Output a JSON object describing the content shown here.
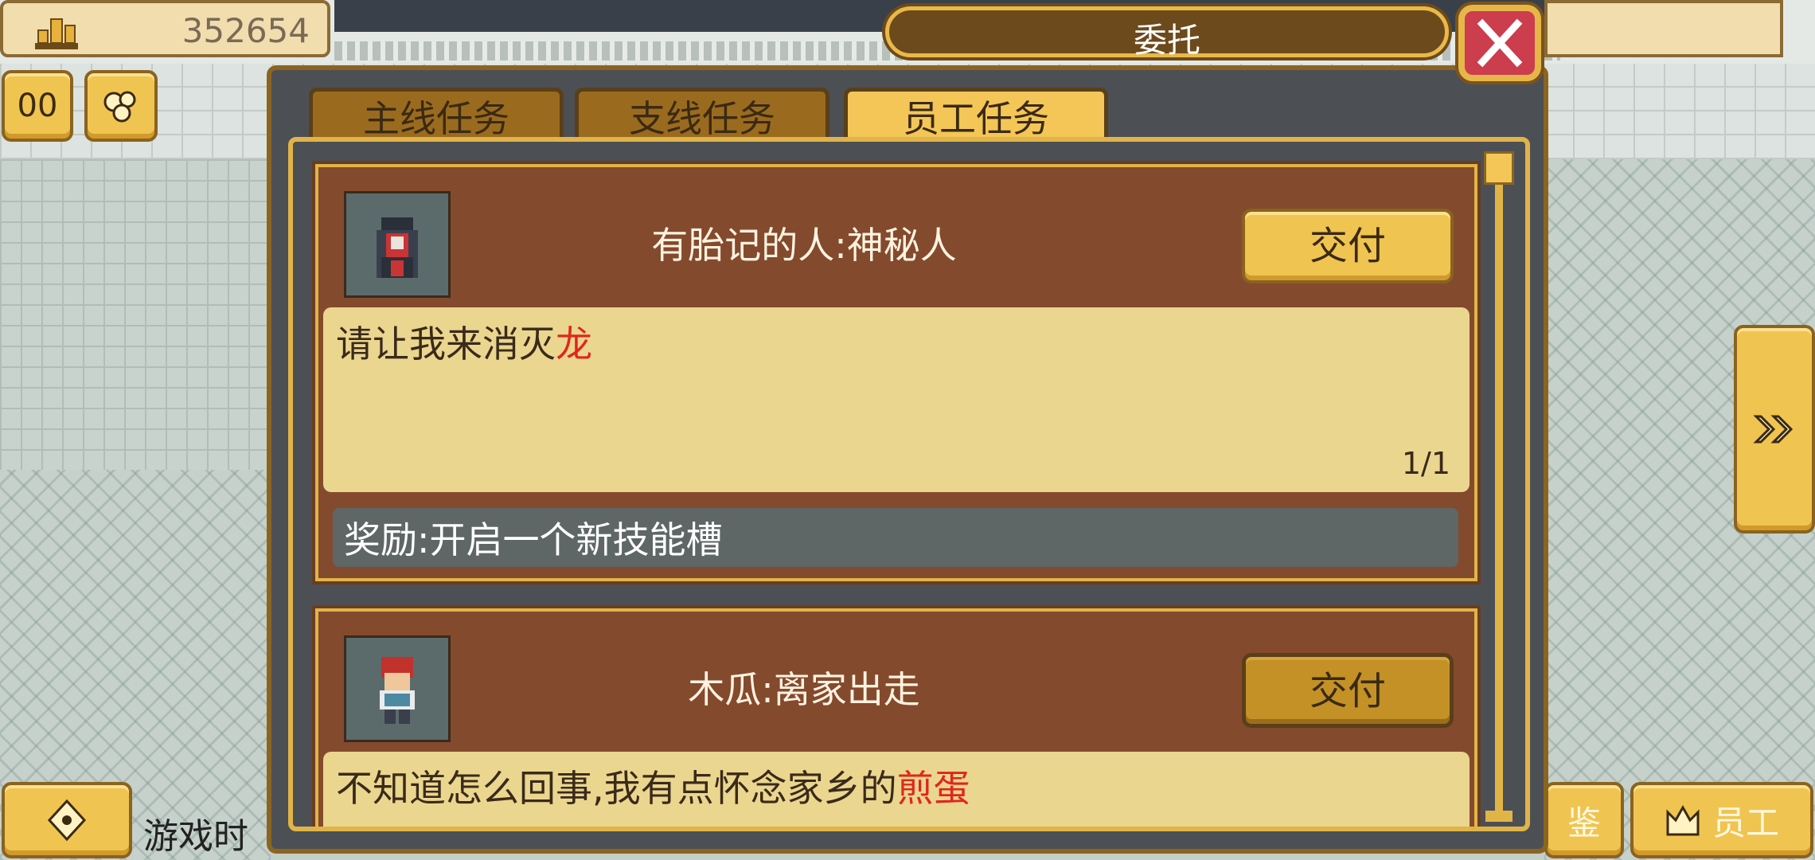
{
  "hud": {
    "gold_amount": "352654",
    "gold_icon": "coin-stack-icon",
    "pause_label": "00",
    "bottom_left_text": "游戏时",
    "right_button_1_label": "鉴",
    "right_button_2_label": "员工"
  },
  "dialog": {
    "title": "委托",
    "close_icon": "close-icon",
    "tabs": [
      {
        "label": "主线任务",
        "active": false
      },
      {
        "label": "支线任务",
        "active": false
      },
      {
        "label": "员工任务",
        "active": true
      }
    ],
    "quests": [
      {
        "title": "有胎记的人:神秘人",
        "deliver_label": "交付",
        "deliver_enabled": true,
        "desc_prefix": "请让我来消灭",
        "desc_highlight": "龙",
        "progress": "1/1",
        "reward": "奖励:开启一个新技能槽",
        "avatar": "hooded-mystery-person-avatar"
      },
      {
        "title": "木瓜:离家出走",
        "deliver_label": "交付",
        "deliver_enabled": false,
        "desc_prefix": "不知道怎么回事,我有点怀念家乡的",
        "desc_highlight": "煎蛋",
        "avatar": "red-haired-boy-avatar"
      }
    ]
  },
  "colors": {
    "accent_gold": "#f3c657",
    "card_brown": "#844a2e",
    "highlight_red": "#e0261e",
    "close_red": "#cc3d4d"
  }
}
